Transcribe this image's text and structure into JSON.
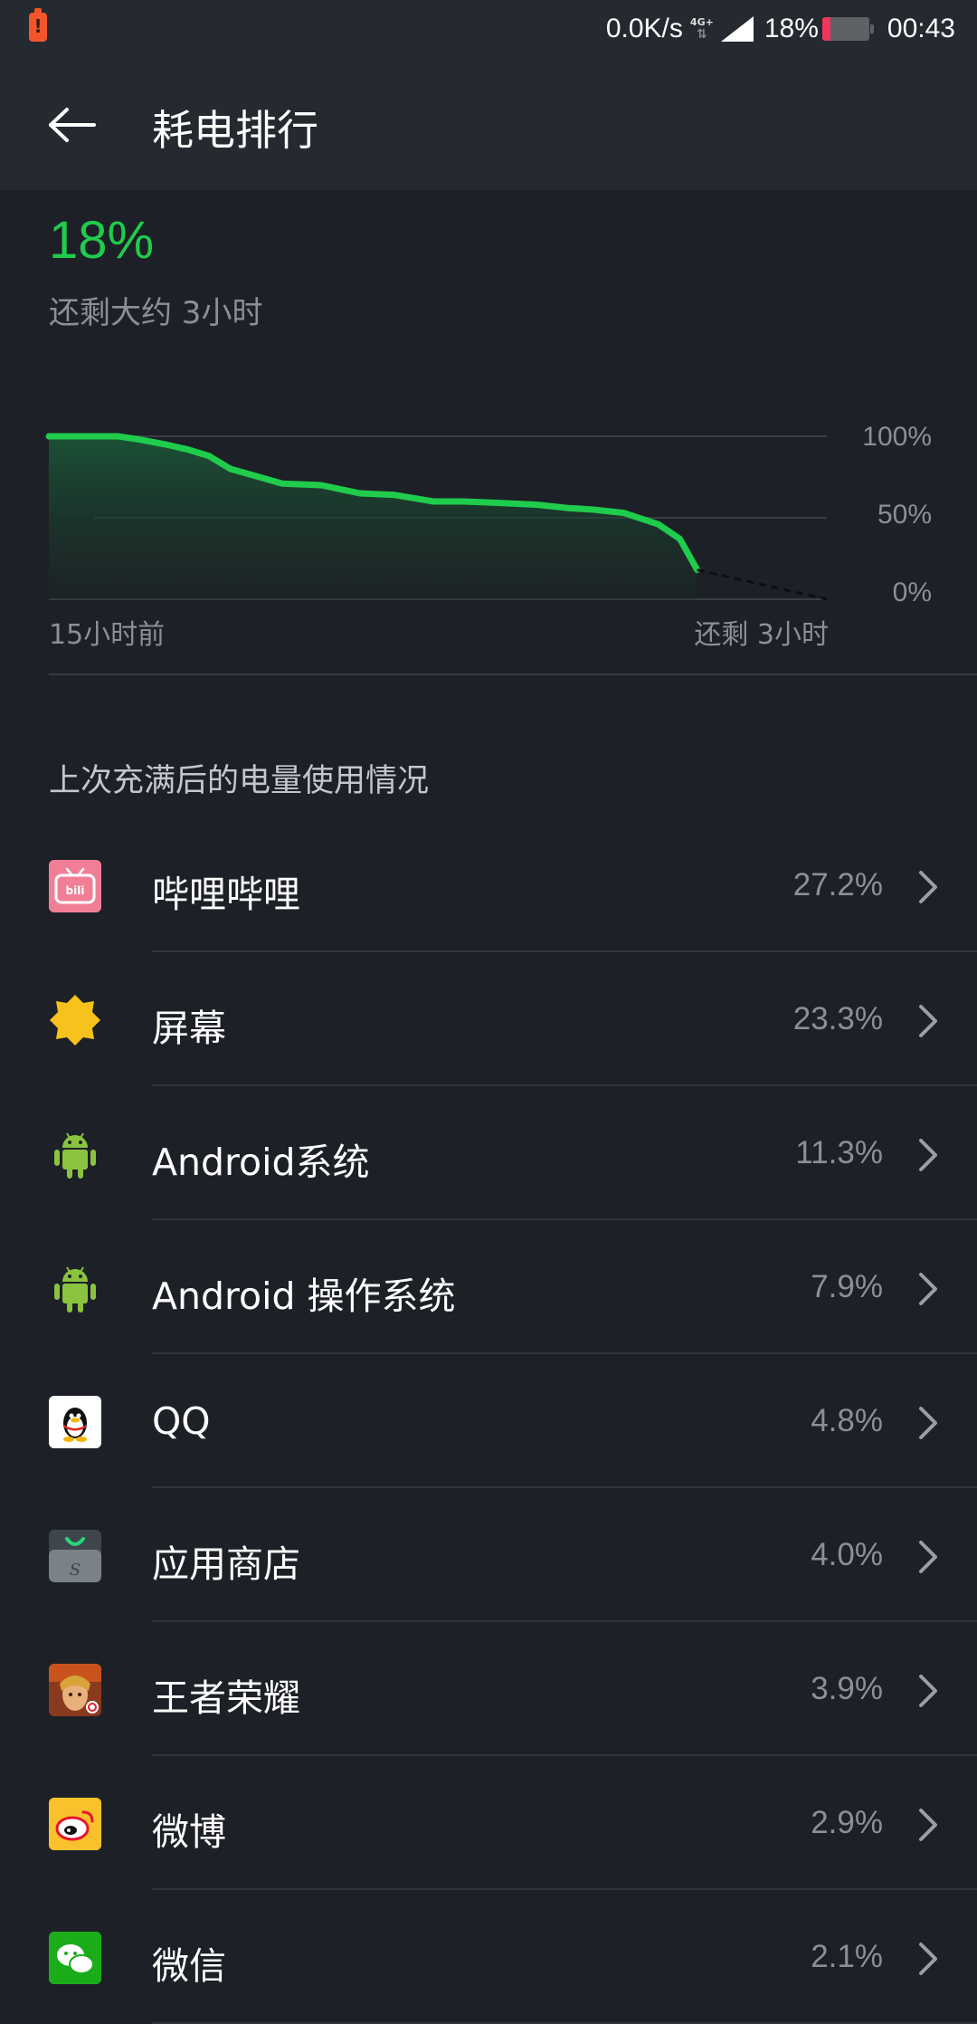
{
  "status_bar": {
    "alert_icon": "battery-alert-icon",
    "net_speed": "0.0K/s",
    "network_type": "4G+",
    "signal_icon": "signal-icon",
    "battery_pct": "18%",
    "battery_level": 0.18,
    "time": "00:43"
  },
  "header": {
    "back_icon": "arrow-left-icon",
    "title": "耗电排行"
  },
  "summary": {
    "percent": "18%",
    "remaining": "还剩大约 3小时"
  },
  "chart_data": {
    "type": "line",
    "y_ticks": [
      "100%",
      "50%",
      "0%"
    ],
    "x_labels": [
      "15小时前",
      "还剩 3小时"
    ],
    "ylim": [
      0,
      100
    ],
    "x_hours": [
      0,
      0.45,
      1.0,
      1.6,
      2.1,
      2.7,
      3.2,
      3.7,
      4.2,
      4.6,
      5.4,
      6.3,
      7.2,
      8.0,
      8.9,
      9.6,
      10.5,
      11.3,
      12.0,
      12.6,
      13.3,
      14.1,
      14.6,
      15.0
    ],
    "battery_pct": [
      100,
      100,
      100,
      100,
      98,
      95,
      92,
      88,
      80,
      77,
      71,
      70,
      65,
      64,
      60,
      60,
      59,
      58,
      56,
      55,
      53,
      46,
      37,
      18
    ],
    "projection_end_hours": 18,
    "line_color": "#1fcc4c",
    "grid": true
  },
  "section_title": "上次充满后的电量使用情况",
  "apps": [
    {
      "name": "哔哩哔哩",
      "percent": "27.2%",
      "icon": "bilibili-icon"
    },
    {
      "name": "屏幕",
      "percent": "23.3%",
      "icon": "screen-brightness-icon"
    },
    {
      "name": "Android系统",
      "percent": "11.3%",
      "icon": "android-icon"
    },
    {
      "name": "Android 操作系统",
      "percent": "7.9%",
      "icon": "android-icon"
    },
    {
      "name": "QQ",
      "percent": "4.8%",
      "icon": "qq-penguin-icon"
    },
    {
      "name": "应用商店",
      "percent": "4.0%",
      "icon": "app-store-icon"
    },
    {
      "name": "王者荣耀",
      "percent": "3.9%",
      "icon": "honor-of-kings-icon"
    },
    {
      "name": "微博",
      "percent": "2.9%",
      "icon": "weibo-icon"
    },
    {
      "name": "微信",
      "percent": "2.1%",
      "icon": "wechat-icon"
    }
  ]
}
